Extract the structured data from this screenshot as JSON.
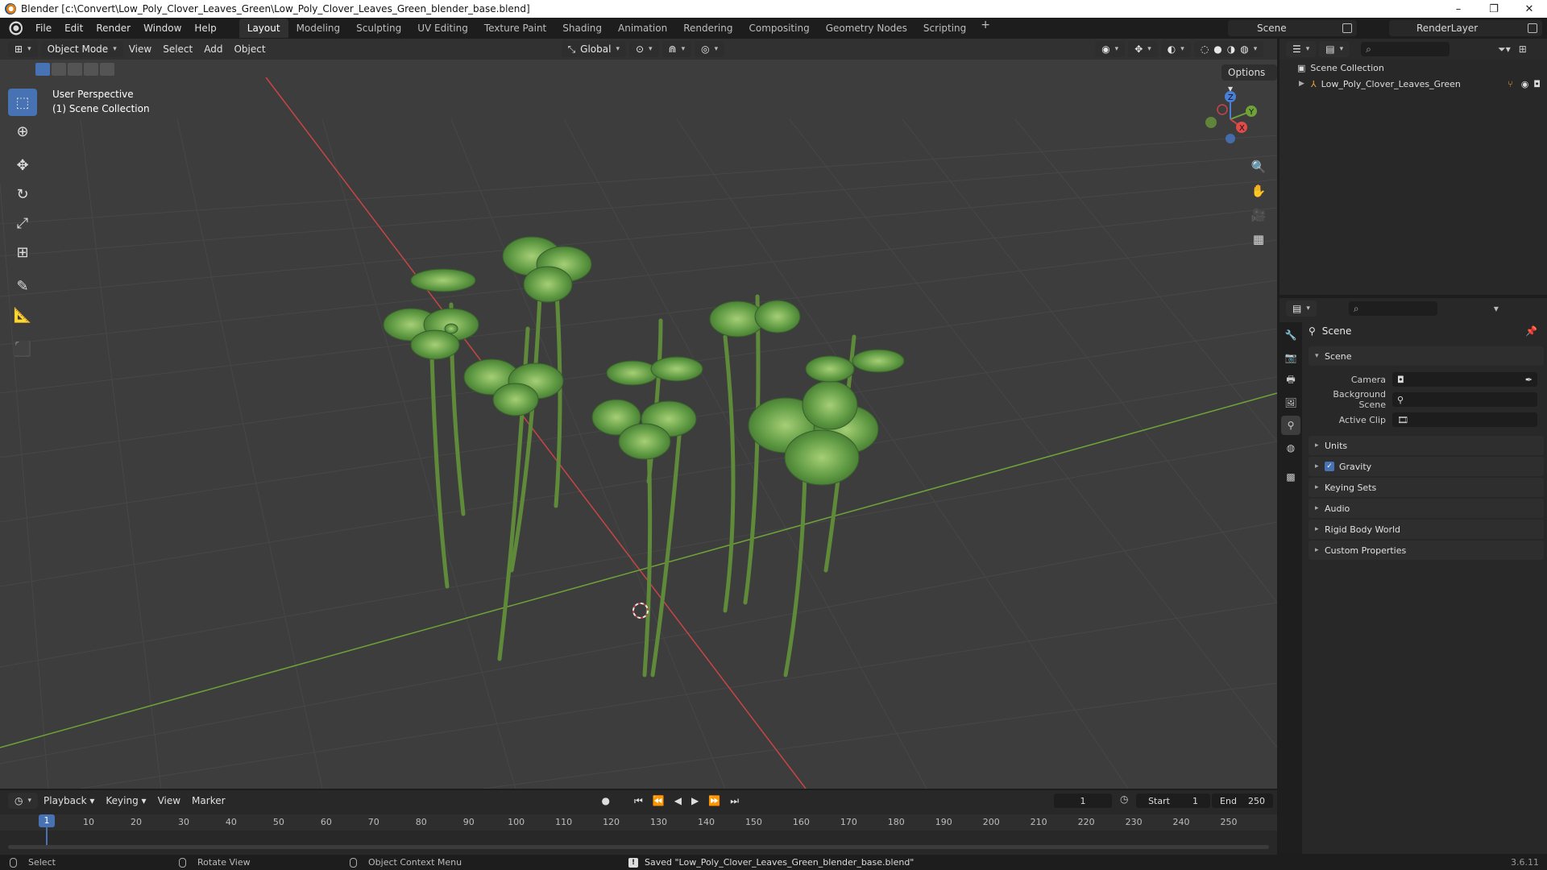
{
  "window": {
    "title": "Blender [c:\\Convert\\Low_Poly_Clover_Leaves_Green\\Low_Poly_Clover_Leaves_Green_blender_base.blend]",
    "minimize": "–",
    "maximize": "❐",
    "close": "✕"
  },
  "menu": [
    "File",
    "Edit",
    "Render",
    "Window",
    "Help"
  ],
  "workspaces": [
    "Layout",
    "Modeling",
    "Sculpting",
    "UV Editing",
    "Texture Paint",
    "Shading",
    "Animation",
    "Rendering",
    "Compositing",
    "Geometry Nodes",
    "Scripting"
  ],
  "active_workspace": "Layout",
  "workspace_add": "+",
  "scene_selector": "Scene",
  "view_layer": "RenderLayer",
  "viewport": {
    "mode": "Object Mode",
    "menus": [
      "View",
      "Select",
      "Add",
      "Object"
    ],
    "transform_orientation": "Global",
    "options": "Options",
    "info_line1": "User Perspective",
    "info_line2": "(1) Scene Collection",
    "axes": {
      "x": "X",
      "y": "Y",
      "z": "Z"
    }
  },
  "outliner": {
    "collection": "Scene Collection",
    "object": "Low_Poly_Clover_Leaves_Green"
  },
  "properties": {
    "context": "Scene",
    "panel": "Scene",
    "rows": [
      {
        "label": "Camera",
        "value": ""
      },
      {
        "label": "Background Scene",
        "value": ""
      },
      {
        "label": "Active Clip",
        "value": ""
      }
    ],
    "subpanels": [
      "Units",
      "Gravity",
      "Keying Sets",
      "Audio",
      "Rigid Body World",
      "Custom Properties"
    ],
    "gravity_checked": true
  },
  "timeline": {
    "menus": [
      "Playback",
      "Keying",
      "View",
      "Marker"
    ],
    "current_frame": "1",
    "start_label": "Start",
    "start": "1",
    "end_label": "End",
    "end": "250",
    "ruler": [
      "1",
      "10",
      "20",
      "30",
      "40",
      "50",
      "60",
      "70",
      "80",
      "90",
      "100",
      "110",
      "120",
      "130",
      "140",
      "150",
      "160",
      "170",
      "180",
      "190",
      "200",
      "210",
      "220",
      "230",
      "240",
      "250"
    ]
  },
  "statusbar": {
    "select": "Select",
    "rotate": "Rotate View",
    "context_menu": "Object Context Menu",
    "message": "Saved \"Low_Poly_Clover_Leaves_Green_blender_base.blend\"",
    "version": "3.6.11"
  },
  "colors": {
    "accent": "#4772b3",
    "viewport_bg": "#3d3d3d",
    "x_axis": "#c84545",
    "y_axis": "#6fa337",
    "clover": "#6aa449"
  }
}
